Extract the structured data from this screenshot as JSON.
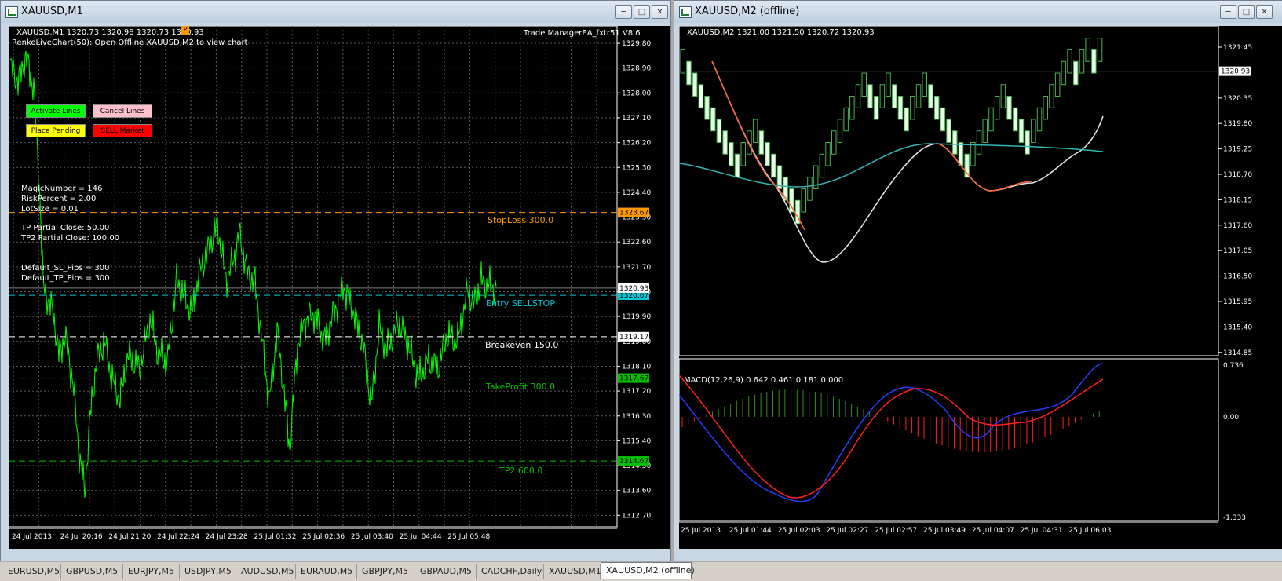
{
  "window_left": {
    "title": "XAUUSD,M1",
    "chart_info": "XAUUSD,M1  1320.73 1320.98 1320.73 1320.93",
    "renko_info": "RenkoLiveChart(50): Open Offline XAUUSD,M2 to view chart",
    "ea_name": "Trade ManagerEA_fxtr51 V8.6",
    "ea_badge": "P",
    "buttons": {
      "activate": "Activate Lines",
      "cancel": "Cancel Lines",
      "place": "Place Pending",
      "sell": "SELL Market"
    },
    "info_lines": [
      "MagicNumber = 146",
      "RiskPercent = 2.00",
      "LotSize = 0.01",
      "TP Partial Close: 50.00",
      "TP2 Partial Close: 100.00",
      "Default_SL_Pips = 300",
      "Default_TP_Pips = 300"
    ],
    "level_labels": {
      "stoploss": "StopLoss  300.0",
      "entry": "Entry SELLSTOP",
      "breakeven": "Breakeven  150.0",
      "takeprofit": "TakeProfit  300.0",
      "tp2": "TP2  600.0"
    },
    "levels": {
      "stoploss": "1323.67",
      "current": "1320.93",
      "entry": "1320.67",
      "breakeven": "1319.17",
      "takeprofit": "1317.67",
      "tp2": "1314.67"
    },
    "price_axis": [
      "1329.80",
      "1328.90",
      "1328.00",
      "1327.10",
      "1326.20",
      "1325.30",
      "1324.40",
      "1323.50",
      "1322.60",
      "1321.70",
      "1320.80",
      "1319.90",
      "1319.00",
      "1318.10",
      "1317.20",
      "1316.30",
      "1315.40",
      "1314.50",
      "1313.60",
      "1312.70"
    ],
    "time_axis": [
      "24 Jul 2013",
      "24 Jul 20:16",
      "24 Jul 21:20",
      "24 Jul 22:24",
      "24 Jul 23:28",
      "25 Jul 01:32",
      "25 Jul 02:36",
      "25 Jul 03:40",
      "25 Jul 04:44",
      "25 Jul 05:48"
    ],
    "colors": {
      "price_line": "#00ff00",
      "stoploss": "#ff9900",
      "entry": "#00c8d8",
      "breakeven": "#ffffff",
      "takeprofit": "#00c000"
    }
  },
  "window_right": {
    "title": "XAUUSD,M2 (offline)",
    "chart_info": "XAUUSD,M2  1321.00 1321.50 1320.72 1320.93",
    "current_price": "1320.93",
    "price_axis": [
      "1321.45",
      "1320.35",
      "1319.80",
      "1319.25",
      "1318.70",
      "1318.15",
      "1317.60",
      "1317.05",
      "1316.50",
      "1315.95",
      "1315.40",
      "1314.85"
    ],
    "macd_label": "MACD(12,26,9) 0.642 0.461 0.181 0.000",
    "macd_axis": [
      "0.736",
      "0.00",
      "-1.333"
    ],
    "time_axis": [
      "25 Jul 2013",
      "25 Jul 01:44",
      "25 Jul 02:03",
      "25 Jul 02:27",
      "25 Jul 02:57",
      "25 Jul 03:49",
      "25 Jul 04:07",
      "25 Jul 04:31",
      "25 Jul 06:03"
    ]
  },
  "tabs": [
    "EURUSD,M5",
    "GBPUSD,M5",
    "EURJPY,M5",
    "USDJPY,M5",
    "AUDUSD,M5",
    "EURAUD,M5",
    "GBPJPY,M5",
    "GBPAUD,M5",
    "CADCHF,Daily",
    "XAUUSD,M1",
    "XAUUSD,M2 (offline)"
  ],
  "active_tab": "XAUUSD,M2 (offline)"
}
